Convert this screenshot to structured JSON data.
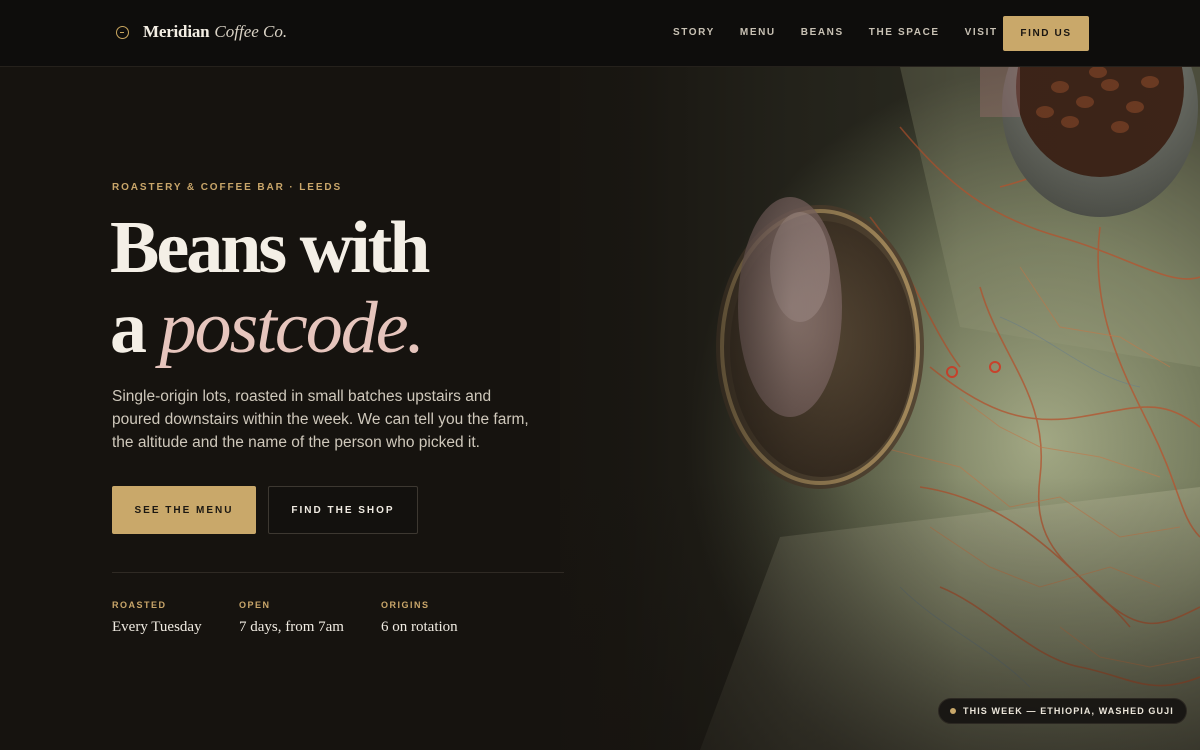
{
  "brand": {
    "name": "Meridian",
    "suffix": "Coffee Co.",
    "icon": "compass-icon"
  },
  "nav": {
    "items": [
      {
        "label": "STORY"
      },
      {
        "label": "MENU"
      },
      {
        "label": "BEANS"
      },
      {
        "label": "THE SPACE"
      },
      {
        "label": "VISIT"
      }
    ],
    "cta_label": "FIND US"
  },
  "hero": {
    "eyebrow": "ROASTERY & COFFEE BAR · LEEDS",
    "headline_line1": "Beans with",
    "headline_line2_prefix": "a ",
    "headline_line2_accent": "postcode.",
    "lede": "Single-origin lots, roasted in small batches upstairs and poured downstairs within the week. We can tell you the farm, the altitude and the name of the person who picked it.",
    "primary_button": "SEE THE MENU",
    "secondary_button": "FIND THE SHOP",
    "background_image": "map-and-coffee-photo"
  },
  "stats": [
    {
      "label": "ROASTED",
      "value": "Every Tuesday"
    },
    {
      "label": "OPEN",
      "value": "7 days, from 7am"
    },
    {
      "label": "ORIGINS",
      "value": "6 on rotation"
    }
  ],
  "announcement": {
    "text": "THIS WEEK — ETHIOPIA, WASHED GUJI"
  },
  "colors": {
    "accent": "#c9a86a",
    "headline_accent": "#e6c5bd",
    "background": "#141210",
    "header_bg": "#0e0d0c"
  }
}
